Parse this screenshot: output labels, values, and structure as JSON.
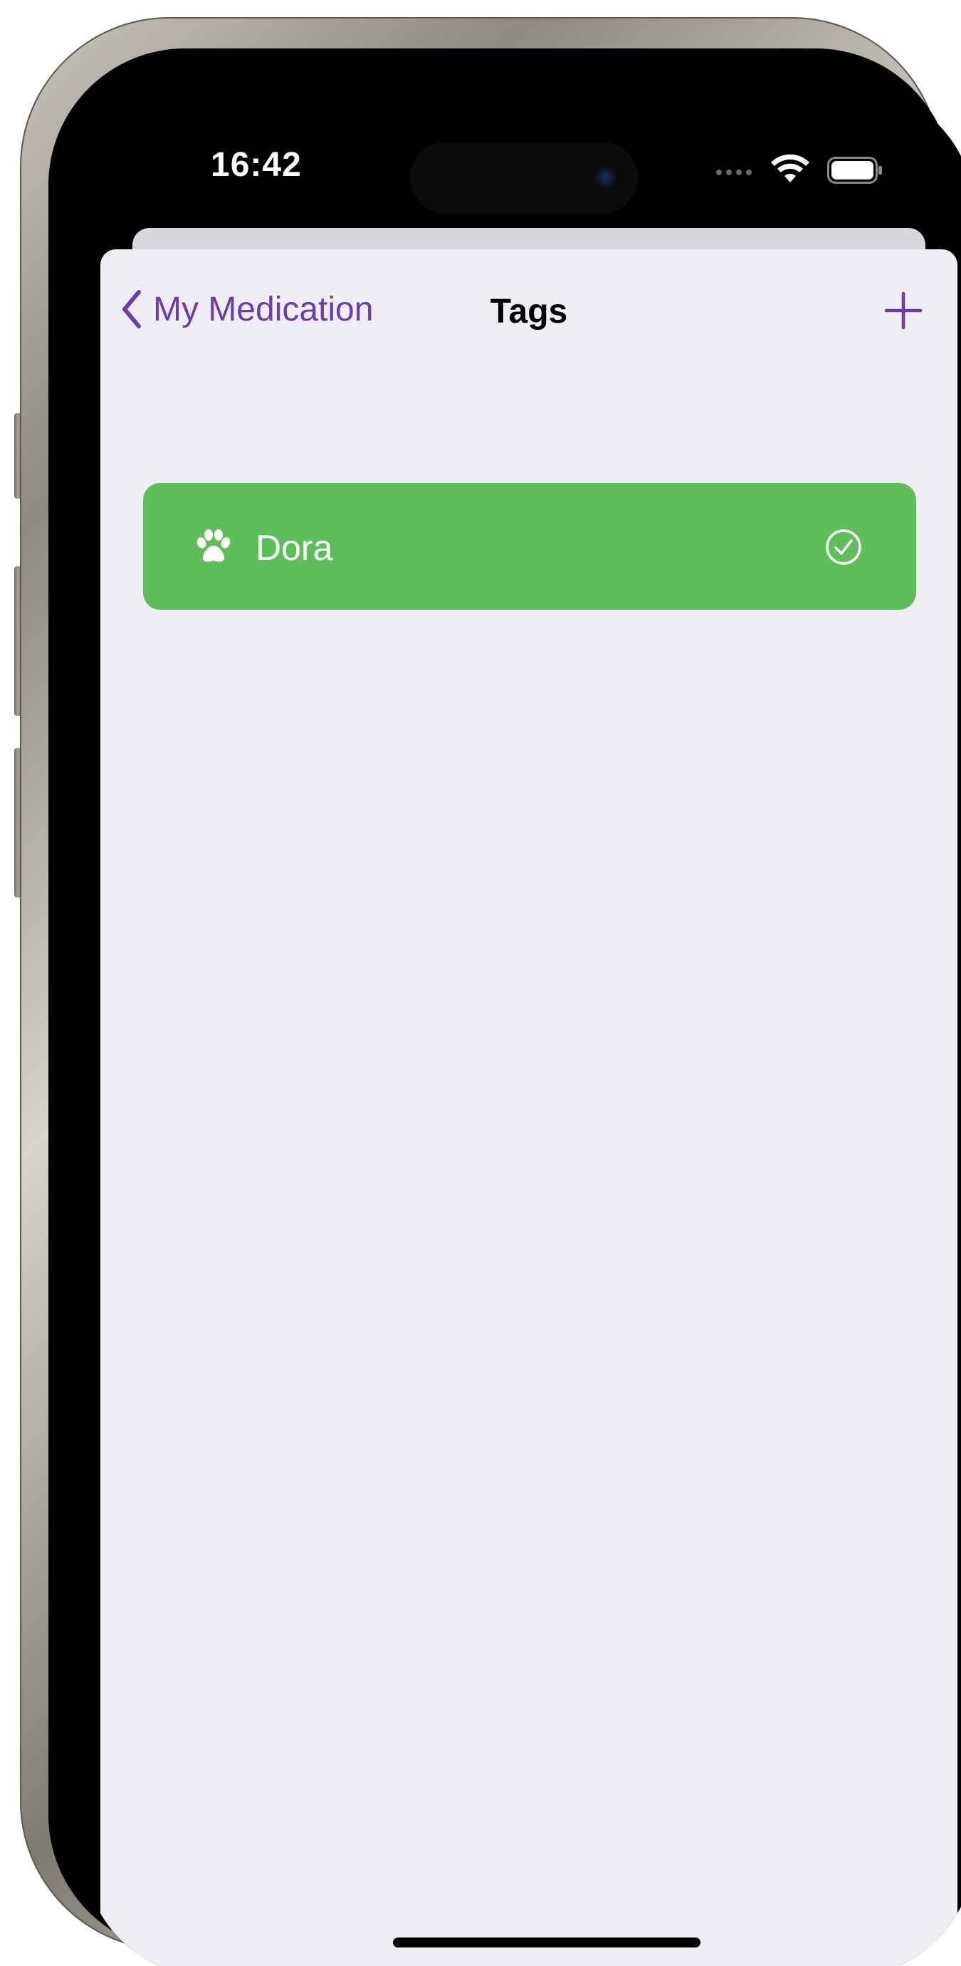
{
  "status_bar": {
    "time": "16:42",
    "icons": [
      "signal-dots-icon",
      "wifi-icon",
      "battery-icon"
    ]
  },
  "nav": {
    "back_label": "My Medication",
    "title": "Tags",
    "add_icon": "plus-icon"
  },
  "tags": [
    {
      "label": "Dora",
      "icon": "paw-icon",
      "selected": true,
      "color": "#5dbe5a"
    }
  ],
  "colors": {
    "accent": "#6a3cae",
    "background": "#efeef5",
    "tag_green": "#5dbe5a"
  }
}
